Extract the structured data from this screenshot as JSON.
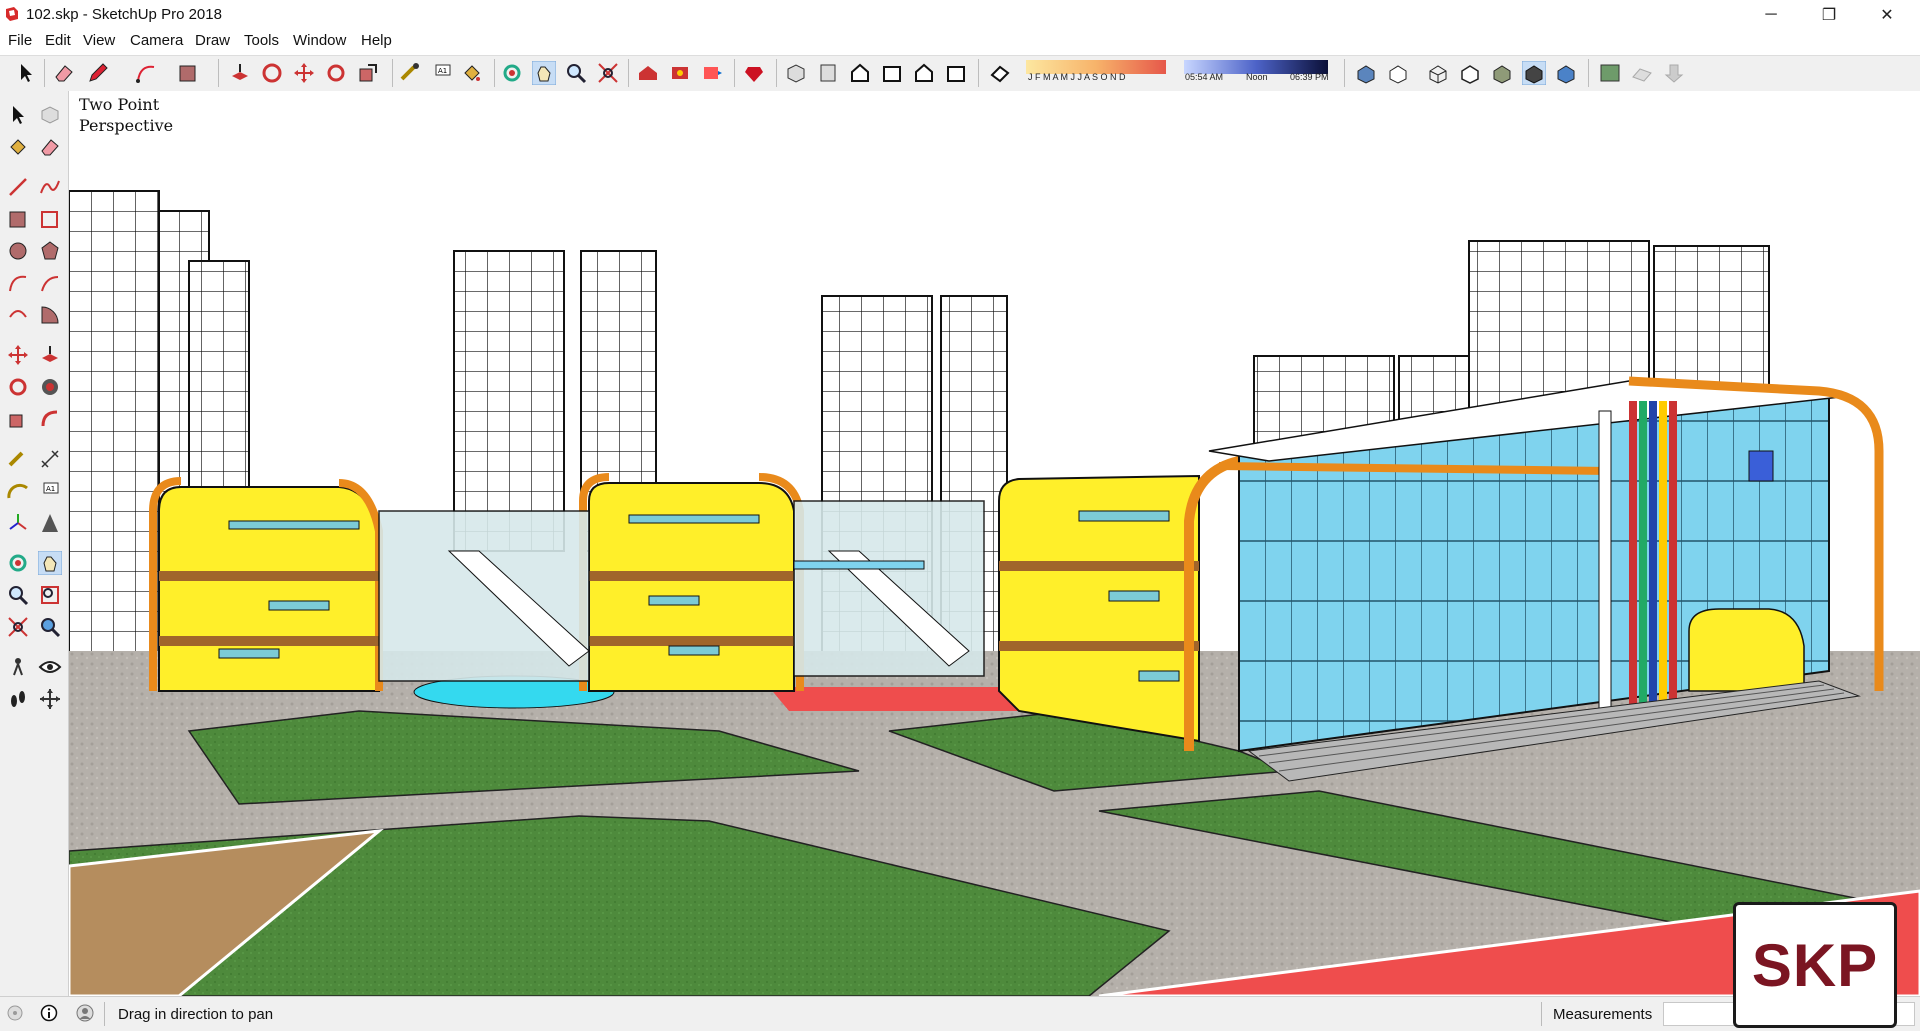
{
  "window": {
    "title": "102.skp - SketchUp Pro 2018",
    "minimize": "─",
    "maximize": "❐",
    "close": "✕"
  },
  "menu": [
    "File",
    "Edit",
    "View",
    "Camera",
    "Draw",
    "Tools",
    "Window",
    "Help"
  ],
  "shadow_settings": {
    "months": "J F M A M J J A S O N D",
    "time_start": "05:54 AM",
    "time_noon": "Noon",
    "time_end": "06:39 PM"
  },
  "viewport": {
    "camera_label_line1": "Two Point",
    "camera_label_line2": "Perspective",
    "watermark": "SKP"
  },
  "status": {
    "hint": "Drag in direction to pan",
    "measurements_label": "Measurements",
    "measurements_value": ""
  },
  "colors": {
    "facade_yellow": "#ffef2a",
    "trim_orange": "#e98a1b",
    "glass_blue": "#7fd3ee",
    "lawn_green": "#4e8a3c",
    "path_gray": "#a9a9a9",
    "plaza_red": "#ef4d4d",
    "pool_cyan": "#34d9ef",
    "brand_maroon": "#7b1522"
  }
}
